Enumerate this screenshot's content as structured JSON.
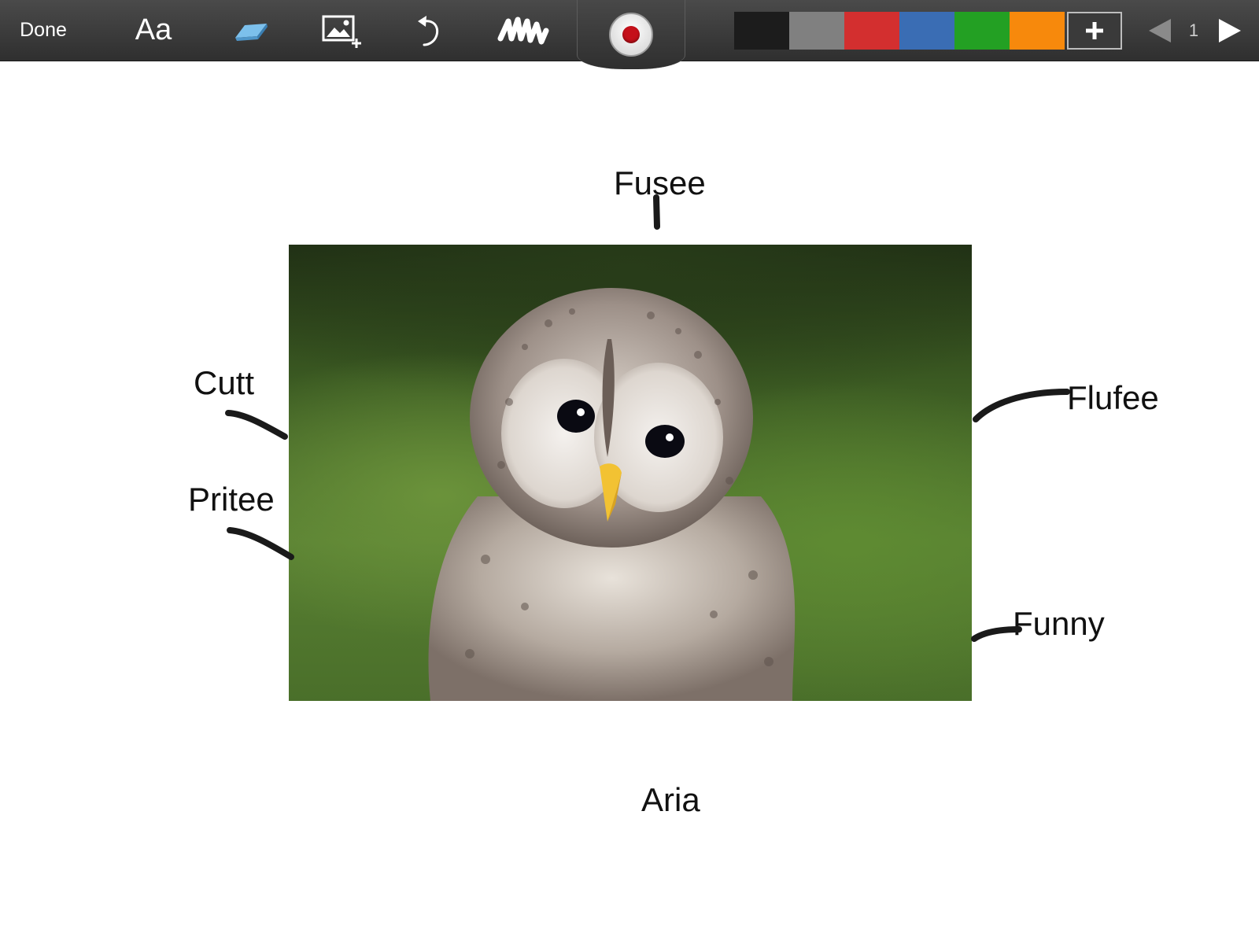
{
  "toolbar": {
    "done_label": "Done",
    "text_tool_label": "Aa",
    "tools": [
      "eraser-icon",
      "add-image-icon",
      "undo-icon",
      "brush-icon",
      "record-icon"
    ],
    "colors": [
      "#1c1c1c",
      "#808080",
      "#d32f2f",
      "#3a6db4",
      "#23a023",
      "#f7890c"
    ],
    "add_color_label": "+",
    "page_number": "1"
  },
  "canvas": {
    "labels": {
      "top": "Fusee",
      "left_upper": "Cutt",
      "left_lower": "Pritee",
      "right_upper": "Flufee",
      "right_lower": "Funny",
      "bottom": "Aria"
    },
    "ink_color": "#1a1a1a"
  }
}
